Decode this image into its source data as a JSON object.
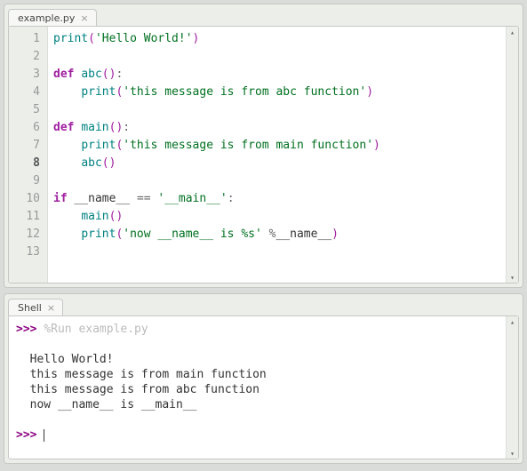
{
  "editor": {
    "tab_label": "example.py",
    "line_count": 13,
    "current_line": 8,
    "code_lines": [
      [
        [
          "fn",
          "print"
        ],
        [
          "paren",
          "("
        ],
        [
          "str",
          "'Hello World!'"
        ],
        [
          "paren",
          ")"
        ]
      ],
      [],
      [
        [
          "kw",
          "def "
        ],
        [
          "fn",
          "abc"
        ],
        [
          "paren",
          "()"
        ],
        [
          "punc",
          ":"
        ]
      ],
      [
        [
          "name",
          "    "
        ],
        [
          "fn",
          "print"
        ],
        [
          "paren",
          "("
        ],
        [
          "str",
          "'this message is from abc function'"
        ],
        [
          "paren",
          ")"
        ]
      ],
      [],
      [
        [
          "kw",
          "def "
        ],
        [
          "fn",
          "main"
        ],
        [
          "paren",
          "()"
        ],
        [
          "punc",
          ":"
        ]
      ],
      [
        [
          "name",
          "    "
        ],
        [
          "fn",
          "print"
        ],
        [
          "paren",
          "("
        ],
        [
          "str",
          "'this message is from main function'"
        ],
        [
          "paren",
          ")"
        ]
      ],
      [
        [
          "name",
          "    "
        ],
        [
          "fn",
          "abc"
        ],
        [
          "paren",
          "()"
        ]
      ],
      [],
      [
        [
          "kw",
          "if "
        ],
        [
          "name",
          "__name__ "
        ],
        [
          "punc",
          "== "
        ],
        [
          "str",
          "'__main__'"
        ],
        [
          "punc",
          ":"
        ]
      ],
      [
        [
          "name",
          "    "
        ],
        [
          "fn",
          "main"
        ],
        [
          "paren",
          "()"
        ]
      ],
      [
        [
          "name",
          "    "
        ],
        [
          "fn",
          "print"
        ],
        [
          "paren",
          "("
        ],
        [
          "str",
          "'now __name__ is %s'"
        ],
        [
          "name",
          " "
        ],
        [
          "punc",
          "%"
        ],
        [
          "name",
          "__name__"
        ],
        [
          "paren",
          ")"
        ]
      ],
      []
    ]
  },
  "shell": {
    "tab_label": "Shell",
    "prompt": ">>>",
    "run_command": "%Run example.py",
    "output_lines": [
      "Hello World!",
      "this message is from main function",
      "this message is from abc function",
      "now __name__ is __main__"
    ]
  }
}
